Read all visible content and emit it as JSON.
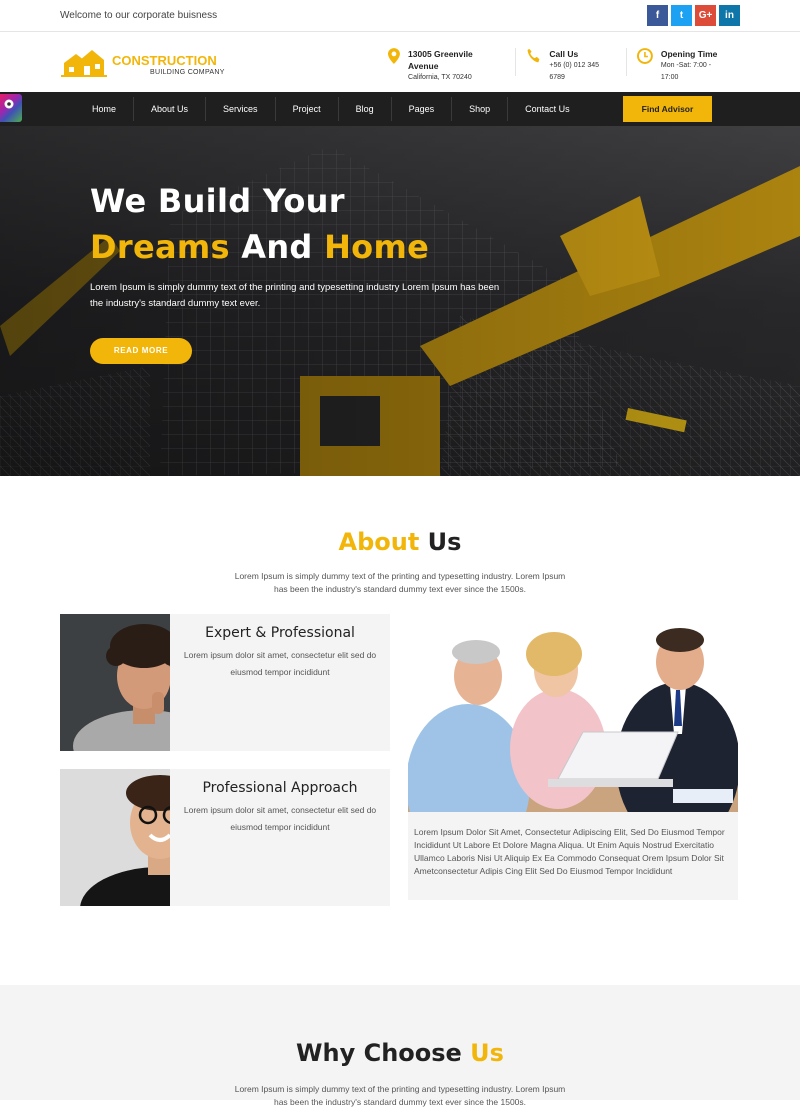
{
  "topbar": {
    "welcome": "Welcome to our corporate buisness",
    "social": [
      {
        "icon": "facebook-icon",
        "glyph": "f",
        "color": "#3b5998"
      },
      {
        "icon": "twitter-icon",
        "glyph": "t",
        "color": "#1da1f2"
      },
      {
        "icon": "google-plus-icon",
        "glyph": "G+",
        "color": "#dd4b39"
      },
      {
        "icon": "linkedin-icon",
        "glyph": "in",
        "color": "#0e76a8"
      }
    ]
  },
  "header": {
    "logo": {
      "line1": "CONSTRUCTION",
      "line2": "BUILDING COMPANY"
    },
    "address": {
      "title": "13005 Greenvile Avenue",
      "sub": "California, TX 70240"
    },
    "phone": {
      "title": "Call Us",
      "sub": "+56 (0) 012 345 6789"
    },
    "hours": {
      "title": "Opening Time",
      "sub": "Mon -Sat: 7:00 - 17:00"
    }
  },
  "nav": {
    "items": [
      "Home",
      "About Us",
      "Services",
      "Project",
      "Blog",
      "Pages",
      "Shop",
      "Contact Us"
    ],
    "cta": "Find Advisor"
  },
  "hero": {
    "line1": "We Build Your",
    "line2_a": "Dreams",
    "line2_b": " And ",
    "line2_c": "Home",
    "text": "Lorem Ipsum is simply dummy text of the printing and typesetting industry Lorem Ipsum has been the industry's standard dummy text ever.",
    "button": "READ MORE"
  },
  "about": {
    "title_a": "About",
    "title_b": " Us",
    "desc": "Lorem Ipsum is simply dummy text of the printing and typesetting industry. Lorem Ipsum has been the industry's standard dummy text ever since the 1500s.",
    "cards": [
      {
        "title": "Expert & Professional",
        "text": "Lorem ipsum dolor sit amet, consectetur elit sed do eiusmod tempor incididunt"
      },
      {
        "title": "Professional Approach",
        "text": "Lorem ipsum dolor sit amet, consectetur elit sed do eiusmod tempor incididunt"
      }
    ],
    "team_text": "Lorem Ipsum Dolor Sit Amet, Consectetur Adipiscing Elit, Sed Do Eiusmod Tempor Incididunt Ut Labore Et Dolore Magna Aliqua. Ut Enim Aquis Nostrud Exercitatio Ullamco Laboris Nisi Ut Aliquip Ex Ea Commodo Consequat Orem Ipsum Dolor Sit Ametconsectetur Adipis Cing Elit Sed Do Eiusmod Tempor Incididunt"
  },
  "why": {
    "title_a": "Why Choose",
    "title_b": " Us",
    "desc": "Lorem Ipsum is simply dummy text of the printing and typesetting industry. Lorem Ipsum has been the industry's standard dummy text ever since the 1500s."
  },
  "colors": {
    "accent": "#f2b60b",
    "nav": "#1f1f1f",
    "panel": "#f4f4f4"
  }
}
